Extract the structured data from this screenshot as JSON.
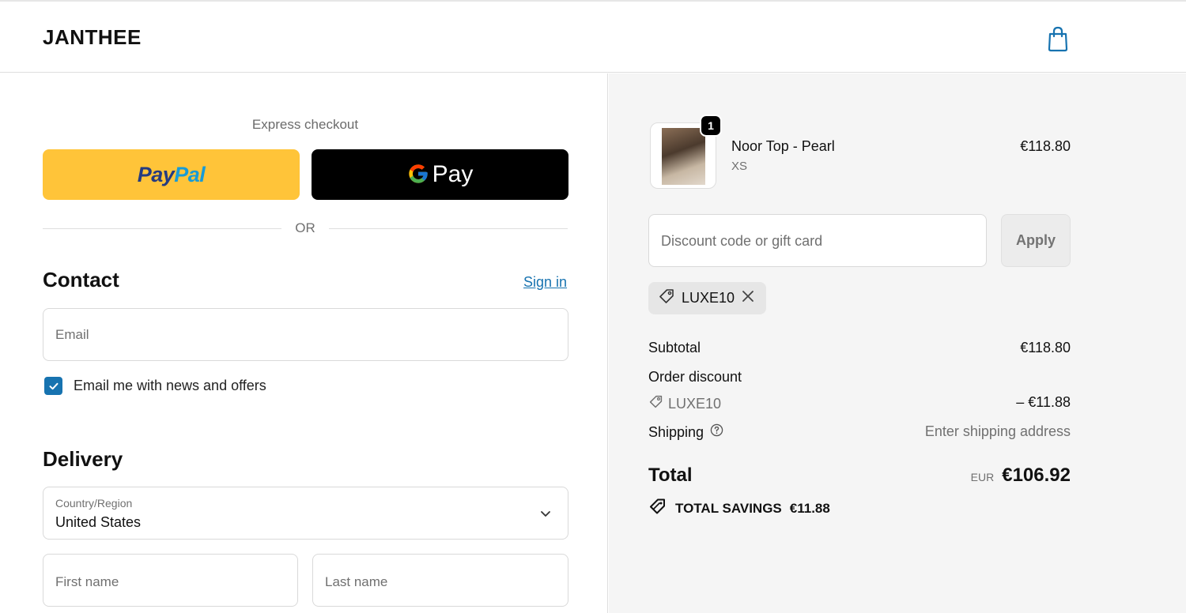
{
  "header": {
    "brand": "JANTHEE",
    "cart_icon": "shopping-bag-icon"
  },
  "express": {
    "label": "Express checkout",
    "paypal": {
      "pay": "Pay",
      "pal": "Pal"
    },
    "gpay": {
      "label": "Pay",
      "icon": "google-g-icon"
    },
    "or": "OR"
  },
  "contact": {
    "title": "Contact",
    "signin": "Sign in",
    "email_placeholder": "Email",
    "newsletter_label": "Email me with news and offers",
    "newsletter_checked": true
  },
  "delivery": {
    "title": "Delivery",
    "country_label": "Country/Region",
    "country_value": "United States",
    "first_name_placeholder": "First name",
    "last_name_placeholder": "Last name"
  },
  "summary": {
    "product": {
      "name": "Noor Top - Pearl",
      "variant": "XS",
      "price": "€118.80",
      "quantity": "1"
    },
    "discount_placeholder": "Discount code or gift card",
    "apply_label": "Apply",
    "applied_code": "LUXE10",
    "subtotal_label": "Subtotal",
    "subtotal_value": "€118.80",
    "order_discount_label": "Order discount",
    "discount_code": "LUXE10",
    "discount_value": "– €11.88",
    "shipping_label": "Shipping",
    "shipping_value": "Enter shipping address",
    "total_label": "Total",
    "currency": "EUR",
    "total_value": "€106.92",
    "savings_label": "TOTAL SAVINGS",
    "savings_value": "€11.88"
  },
  "colors": {
    "accent": "#1773b0",
    "paypal_yellow": "#ffc439",
    "gpay_black": "#000000",
    "summary_bg": "#f5f5f5"
  }
}
